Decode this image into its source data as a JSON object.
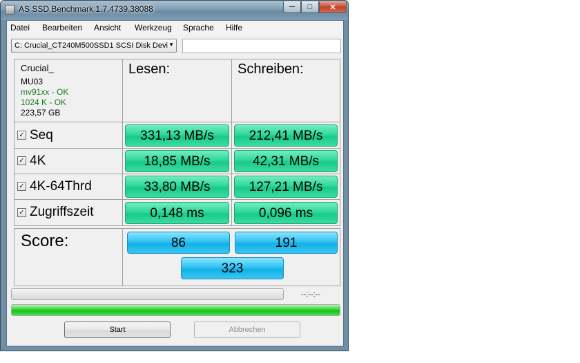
{
  "window": {
    "title": "AS SSD Benchmark 1.7.4739.38088"
  },
  "menu": [
    "Datei",
    "Bearbeiten",
    "Ansicht",
    "Werkzeug",
    "Sprache",
    "Hilfe"
  ],
  "drive_select": {
    "value": "C: Crucial_CT240M500SSD1 SCSI Disk Devi"
  },
  "drive_info": {
    "model": "Crucial_",
    "firmware": "MU03",
    "driver_status": "mv91xx - OK",
    "alignment_status": "1024 K - OK",
    "size": "223,57 GB"
  },
  "columns": {
    "read": "Lesen:",
    "write": "Schreiben:"
  },
  "rows": [
    {
      "label": "Seq",
      "checked": true,
      "read": "331,13 MB/s",
      "write": "212,41 MB/s"
    },
    {
      "label": "4K",
      "checked": true,
      "read": "18,85 MB/s",
      "write": "42,31 MB/s"
    },
    {
      "label": "4K-64Thrd",
      "checked": true,
      "read": "33,80 MB/s",
      "write": "127,21 MB/s"
    },
    {
      "label": "Zugriffszeit",
      "checked": true,
      "read": "0,148 ms",
      "write": "0,096 ms"
    }
  ],
  "score": {
    "label": "Score:",
    "read": "86",
    "write": "191",
    "total": "323"
  },
  "progress": {
    "elapsed": "--:--:--",
    "overall_fraction": 1.0
  },
  "buttons": {
    "start": "Start",
    "abort": "Abbrechen"
  },
  "colors": {
    "value_cell": "#2fd89d",
    "score_cell": "#2ec3f2",
    "progress_fill": "#14c614"
  }
}
